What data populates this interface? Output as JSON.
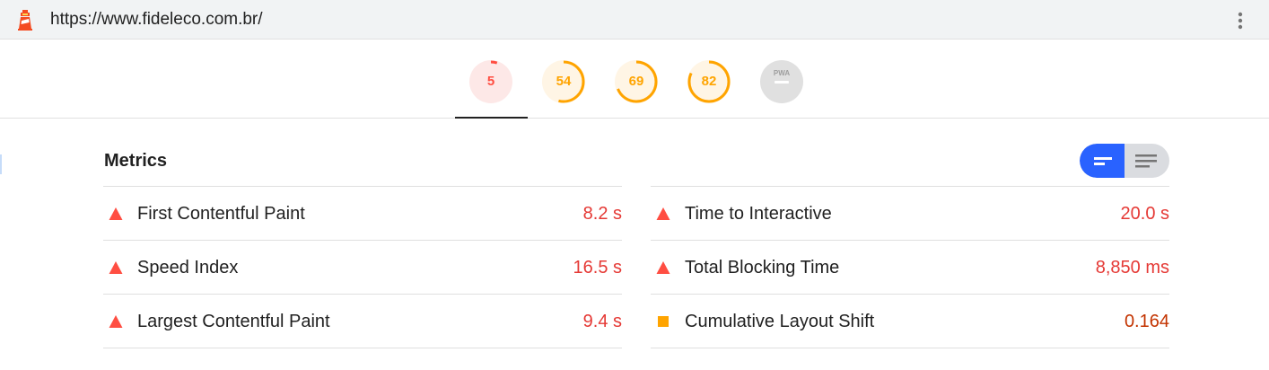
{
  "browser": {
    "url": "https://www.fideleco.com.br/",
    "logo_icon": "lighthouse-icon",
    "menu_icon": "more-vert-icon"
  },
  "scores": [
    {
      "name": "performance",
      "value": "5",
      "score": 5,
      "color": "#ff4e42",
      "bg": "#fde8e7"
    },
    {
      "name": "accessibility",
      "value": "54",
      "score": 54,
      "color": "#ffa400",
      "bg": "#fff5e5"
    },
    {
      "name": "best-practices",
      "value": "69",
      "score": 69,
      "color": "#ffa400",
      "bg": "#fff5e5"
    },
    {
      "name": "seo",
      "value": "82",
      "score": 82,
      "color": "#ffa400",
      "bg": "#fff5e5"
    },
    {
      "name": "pwa",
      "value": "PWA",
      "color": "#9e9e9e",
      "bg": "#e0e0e0"
    }
  ],
  "metrics": {
    "title": "Metrics",
    "toggle": {
      "active": "compact-view",
      "inactive": "expanded-view"
    },
    "left": [
      {
        "label": "First Contentful Paint",
        "value": "8.2 s",
        "status": "fail"
      },
      {
        "label": "Speed Index",
        "value": "16.5 s",
        "status": "fail"
      },
      {
        "label": "Largest Contentful Paint",
        "value": "9.4 s",
        "status": "fail"
      }
    ],
    "right": [
      {
        "label": "Time to Interactive",
        "value": "20.0 s",
        "status": "fail"
      },
      {
        "label": "Total Blocking Time",
        "value": "8,850 ms",
        "status": "fail"
      },
      {
        "label": "Cumulative Layout Shift",
        "value": "0.164",
        "status": "average"
      }
    ]
  },
  "colors": {
    "fail": "#e53935",
    "fail_icon": "#ff4e42",
    "average": "#c33300",
    "average_icon": "#ffa400",
    "accent": "#2962ff"
  }
}
